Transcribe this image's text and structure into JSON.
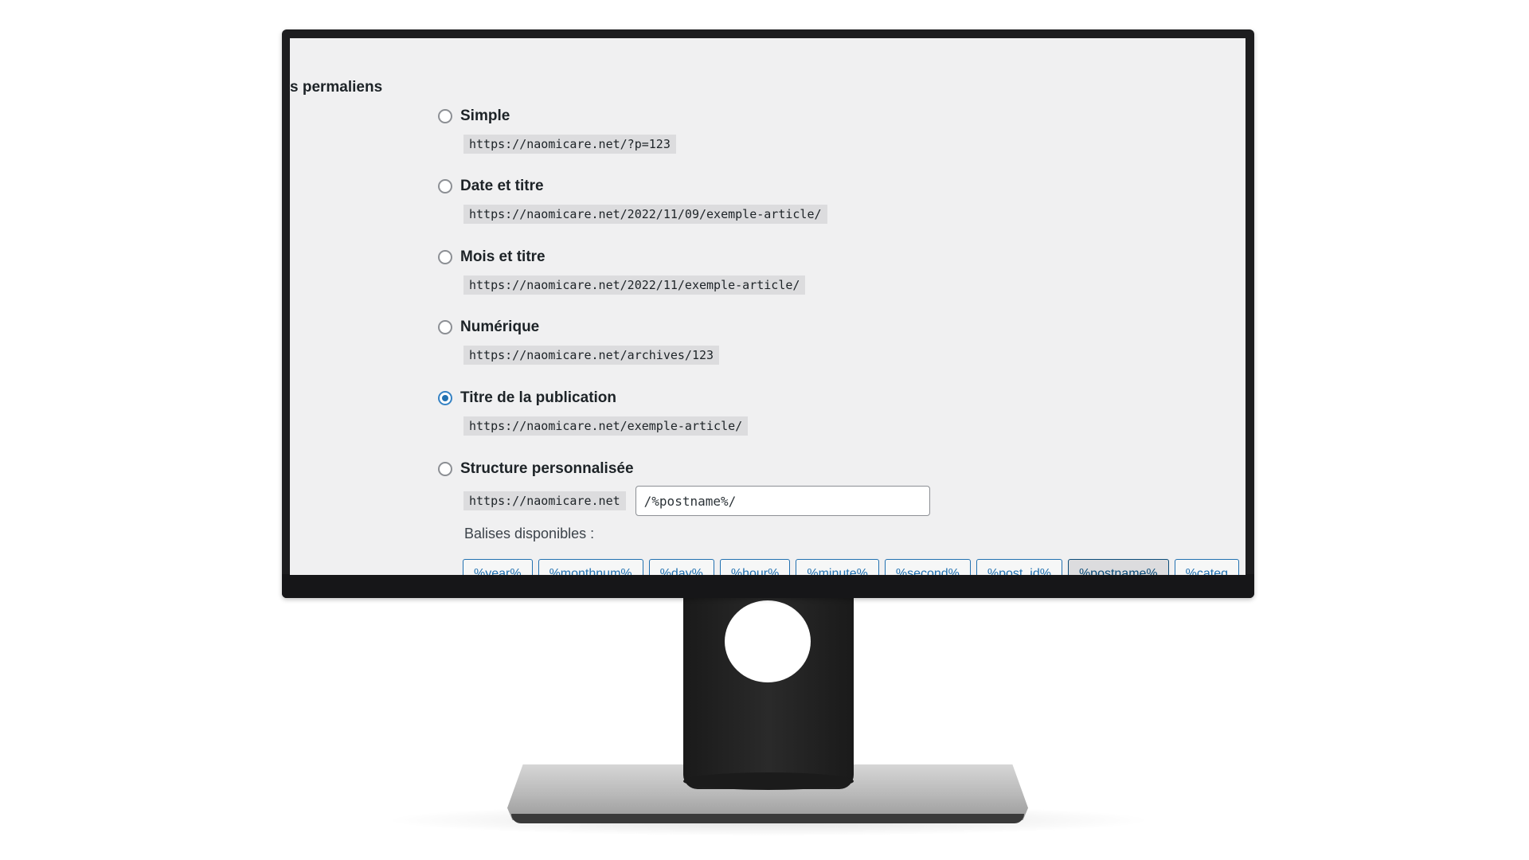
{
  "section_label": "s permaliens",
  "options": [
    {
      "label": "Simple",
      "url": "https://naomicare.net/?p=123",
      "checked": false
    },
    {
      "label": "Date et titre",
      "url": "https://naomicare.net/2022/11/09/exemple-article/",
      "checked": false
    },
    {
      "label": "Mois et titre",
      "url": "https://naomicare.net/2022/11/exemple-article/",
      "checked": false
    },
    {
      "label": "Numérique",
      "url": "https://naomicare.net/archives/123",
      "checked": false
    },
    {
      "label": "Titre de la publication",
      "url": "https://naomicare.net/exemple-article/",
      "checked": true
    }
  ],
  "custom": {
    "label": "Structure personnalisée",
    "checked": false,
    "base_url": "https://naomicare.net",
    "value": "/%postname%/"
  },
  "tags_label": "Balises disponibles :",
  "tags": [
    {
      "label": "%year%",
      "active": false
    },
    {
      "label": "%monthnum%",
      "active": false
    },
    {
      "label": "%day%",
      "active": false
    },
    {
      "label": "%hour%",
      "active": false
    },
    {
      "label": "%minute%",
      "active": false
    },
    {
      "label": "%second%",
      "active": false
    },
    {
      "label": "%post_id%",
      "active": false
    },
    {
      "label": "%postname%",
      "active": true
    },
    {
      "label": "%categ",
      "active": false
    }
  ],
  "colors": {
    "accent": "#2271b1",
    "screen_background": "#f0f0f1",
    "code_background": "#dcdcde"
  }
}
